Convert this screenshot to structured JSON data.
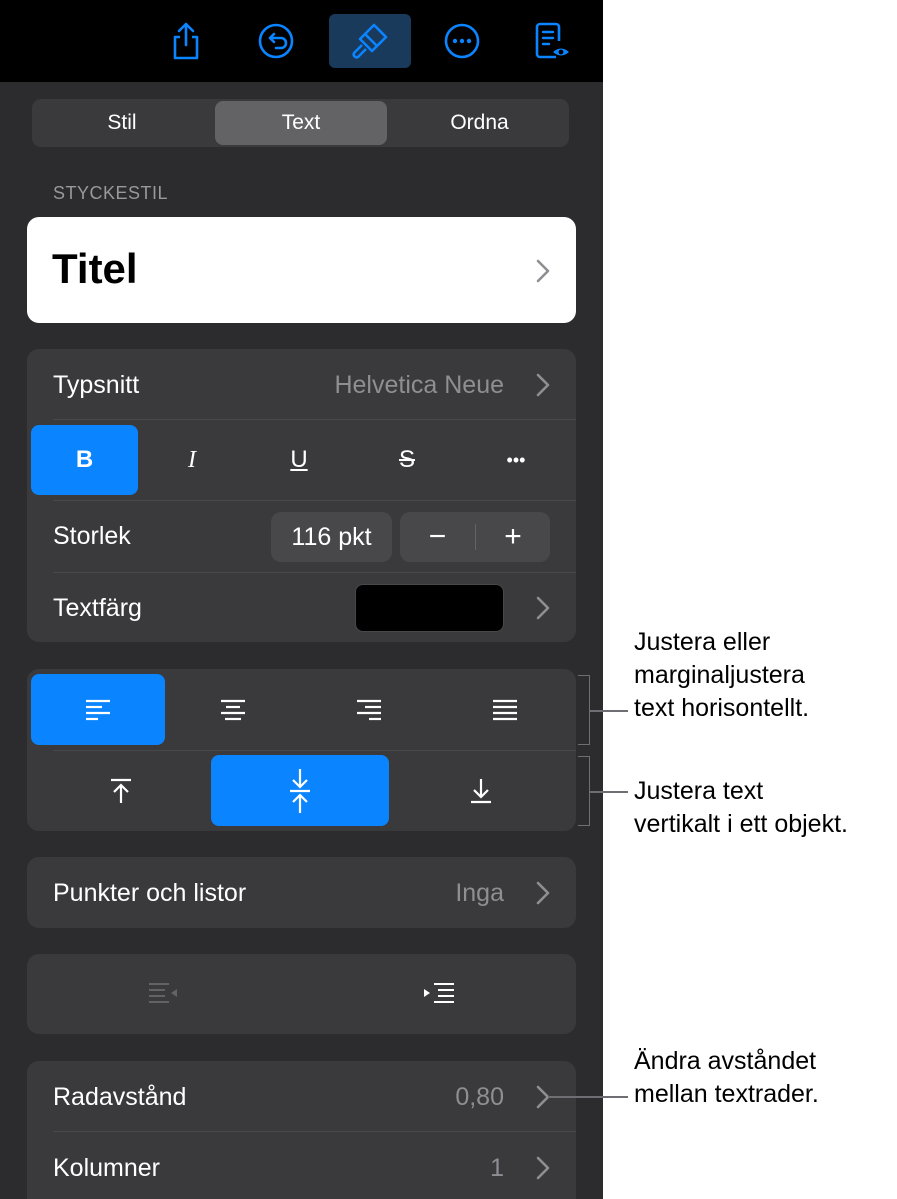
{
  "toolbar": {
    "icons": [
      "share-icon",
      "undo-icon",
      "paintbrush-icon",
      "more-icon",
      "reader-view-icon"
    ],
    "active": "paintbrush-icon",
    "accent": "#0a84ff"
  },
  "tabs": [
    {
      "label": "Stil"
    },
    {
      "label": "Text"
    },
    {
      "label": "Ordna"
    }
  ],
  "active_tab": "Text",
  "paragraph_style": {
    "section_label": "STYCKESTIL",
    "value": "Titel"
  },
  "font": {
    "label": "Typsnitt",
    "value": "Helvetica Neue",
    "styles": [
      "B",
      "I",
      "U",
      "S",
      "•••"
    ],
    "active_style": "B"
  },
  "size": {
    "label": "Storlek",
    "value": "116 pkt",
    "minus": "−",
    "plus": "+"
  },
  "text_color": {
    "label": "Textfärg",
    "swatch": "#000000"
  },
  "horizontal_alignment": {
    "options": [
      "align-left-icon",
      "align-center-icon",
      "align-right-icon",
      "justify-icon"
    ],
    "active": "align-left-icon"
  },
  "vertical_alignment": {
    "options": [
      "align-top-icon",
      "align-middle-icon",
      "align-bottom-icon"
    ],
    "active": "align-middle-icon"
  },
  "bullets": {
    "label": "Punkter och listor",
    "value": "Inga"
  },
  "indent": {
    "options": [
      "decrease-indent-icon",
      "increase-indent-icon"
    ]
  },
  "line_spacing": {
    "label": "Radavstånd",
    "value": "0,80"
  },
  "columns": {
    "label": "Kolumner",
    "value": "1"
  },
  "callouts": {
    "horizontal": [
      "Justera eller",
      "marginaljustera",
      "text horisontellt."
    ],
    "vertical": [
      "Justera text",
      "vertikalt i ett objekt."
    ],
    "spacing": [
      "Ändra avståndet",
      "mellan textrader."
    ]
  }
}
